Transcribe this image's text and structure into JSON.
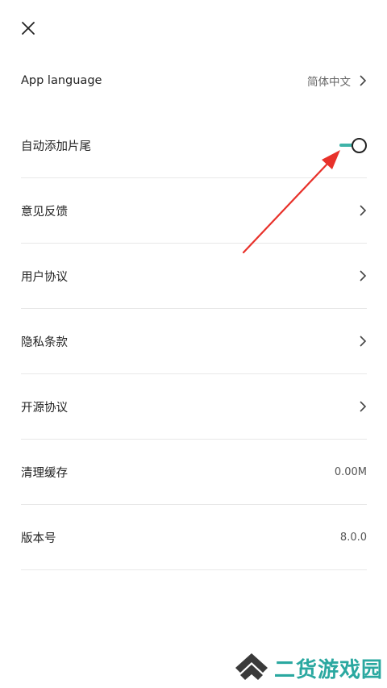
{
  "header": {
    "close_icon": "close-icon"
  },
  "settings": {
    "app_language": {
      "label": "App language",
      "value": "简体中文"
    },
    "auto_add_ending": {
      "label": "自动添加片尾",
      "enabled": true
    },
    "feedback": {
      "label": "意见反馈"
    },
    "user_agreement": {
      "label": "用户协议"
    },
    "privacy_terms": {
      "label": "隐私条款"
    },
    "open_source": {
      "label": "开源协议"
    },
    "clear_cache": {
      "label": "清理缓存",
      "value": "0.00M"
    },
    "version": {
      "label": "版本号",
      "value": "8.0.0"
    }
  },
  "colors": {
    "toggle_accent": "#3fb3a8",
    "annotation_arrow": "#e8312a",
    "watermark": "#2aa8a0"
  },
  "watermark": {
    "text": "二货游戏园"
  }
}
